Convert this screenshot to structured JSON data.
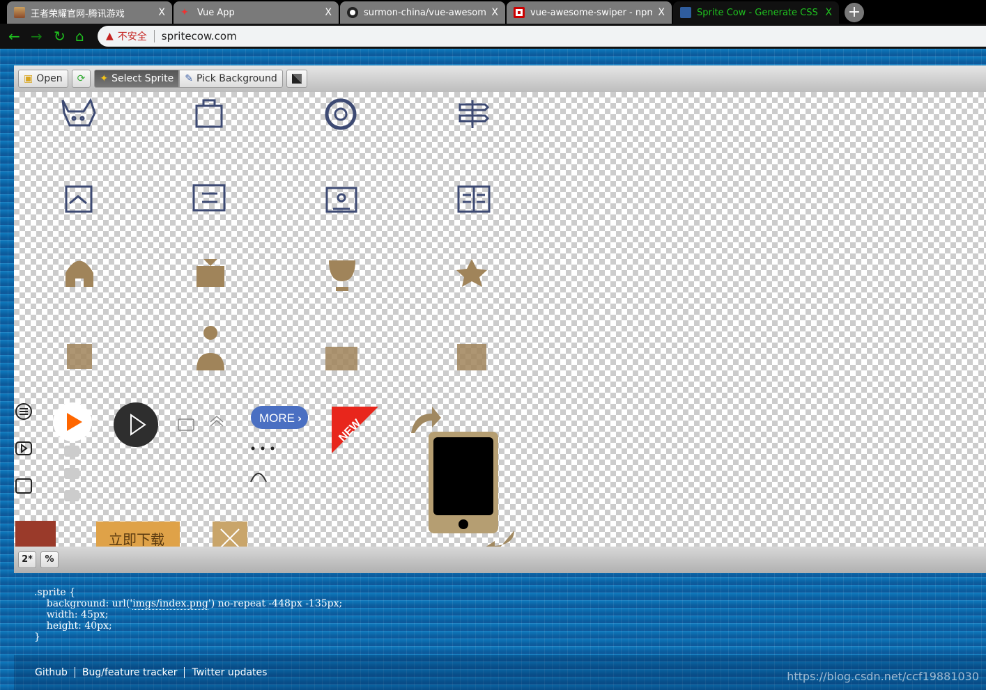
{
  "browser": {
    "tabs": [
      {
        "title": "王者荣耀官网-腾讯游戏",
        "favicon": "game-avatar-icon",
        "active": false
      },
      {
        "title": "Vue App",
        "favicon": "vue-app-icon",
        "active": false
      },
      {
        "title": "surmon-china/vue-awesome-s",
        "favicon": "github-icon",
        "active": false
      },
      {
        "title": "vue-awesome-swiper - npm",
        "favicon": "npm-icon",
        "active": false
      },
      {
        "title": "Sprite Cow - Generate CSS for",
        "favicon": "sprite-cow-icon",
        "active": true
      }
    ],
    "close_glyph": "X",
    "new_tab_glyph": "+",
    "security_label": "不安全",
    "url": "spritecow.com",
    "accent": "#1fc31f"
  },
  "toolbar": {
    "open": "Open",
    "select_sprite": "Select Sprite",
    "pick_background": "Pick Background"
  },
  "sprite_sheet": {
    "more_label": "MORE",
    "new_label": "NEW",
    "download_label": "立即下载"
  },
  "bottom": {
    "retina": "2*",
    "percent": "%"
  },
  "css_output": {
    "line1": ".sprite {",
    "bg_prefix": "    background: url('",
    "bg_url": "imgs/index.png",
    "bg_suffix": "') no-repeat -448px -135px;",
    "width": "    width: 45px;",
    "height": "    height: 40px;",
    "close": "}"
  },
  "footer": {
    "links": [
      "Github",
      "Bug/feature tracker",
      "Twitter updates"
    ],
    "watermark": "https://blog.csdn.net/ccf19881030"
  }
}
